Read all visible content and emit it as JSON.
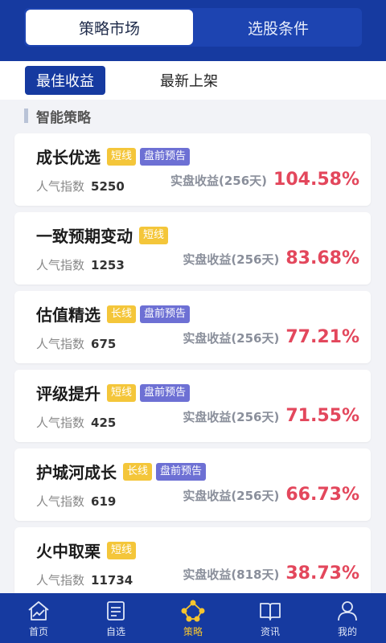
{
  "header": {
    "tabs": [
      {
        "label": "策略市场",
        "active": true
      },
      {
        "label": "选股条件",
        "active": false
      }
    ]
  },
  "subtabs": [
    {
      "label": "最佳收益",
      "active": true
    },
    {
      "label": "最新上架",
      "active": false
    }
  ],
  "section": {
    "title": "智能策略"
  },
  "labels": {
    "popularity": "人气指数"
  },
  "cards": [
    {
      "name": "成长优选",
      "tags": [
        "短线",
        "盘前预告"
      ],
      "popularity": "5250",
      "return_label": "实盘收益(256天)",
      "return_value": "104.58%"
    },
    {
      "name": "一致预期变动",
      "tags": [
        "短线"
      ],
      "popularity": "1253",
      "return_label": "实盘收益(256天)",
      "return_value": "83.68%"
    },
    {
      "name": "估值精选",
      "tags": [
        "长线",
        "盘前预告"
      ],
      "popularity": "675",
      "return_label": "实盘收益(256天)",
      "return_value": "77.21%"
    },
    {
      "name": "评级提升",
      "tags": [
        "短线",
        "盘前预告"
      ],
      "popularity": "425",
      "return_label": "实盘收益(256天)",
      "return_value": "71.55%"
    },
    {
      "name": "护城河成长",
      "tags": [
        "长线",
        "盘前预告"
      ],
      "popularity": "619",
      "return_label": "实盘收益(256天)",
      "return_value": "66.73%"
    },
    {
      "name": "火中取栗",
      "tags": [
        "短线"
      ],
      "popularity": "11734",
      "return_label": "实盘收益(818天)",
      "return_value": "38.73%"
    }
  ],
  "bottom_nav": [
    {
      "label": "首页",
      "icon": "home-chart-icon",
      "active": false
    },
    {
      "label": "自选",
      "icon": "watchlist-icon",
      "active": false
    },
    {
      "label": "策略",
      "icon": "strategy-icon",
      "active": true
    },
    {
      "label": "资讯",
      "icon": "news-book-icon",
      "active": false
    },
    {
      "label": "我的",
      "icon": "user-icon",
      "active": false
    }
  ],
  "colors": {
    "brand": "#163aa0",
    "return": "#e3475c",
    "tag_short": "#f4c63a",
    "tag_pre": "#6d70d4",
    "nav_active": "#f7c52e"
  }
}
